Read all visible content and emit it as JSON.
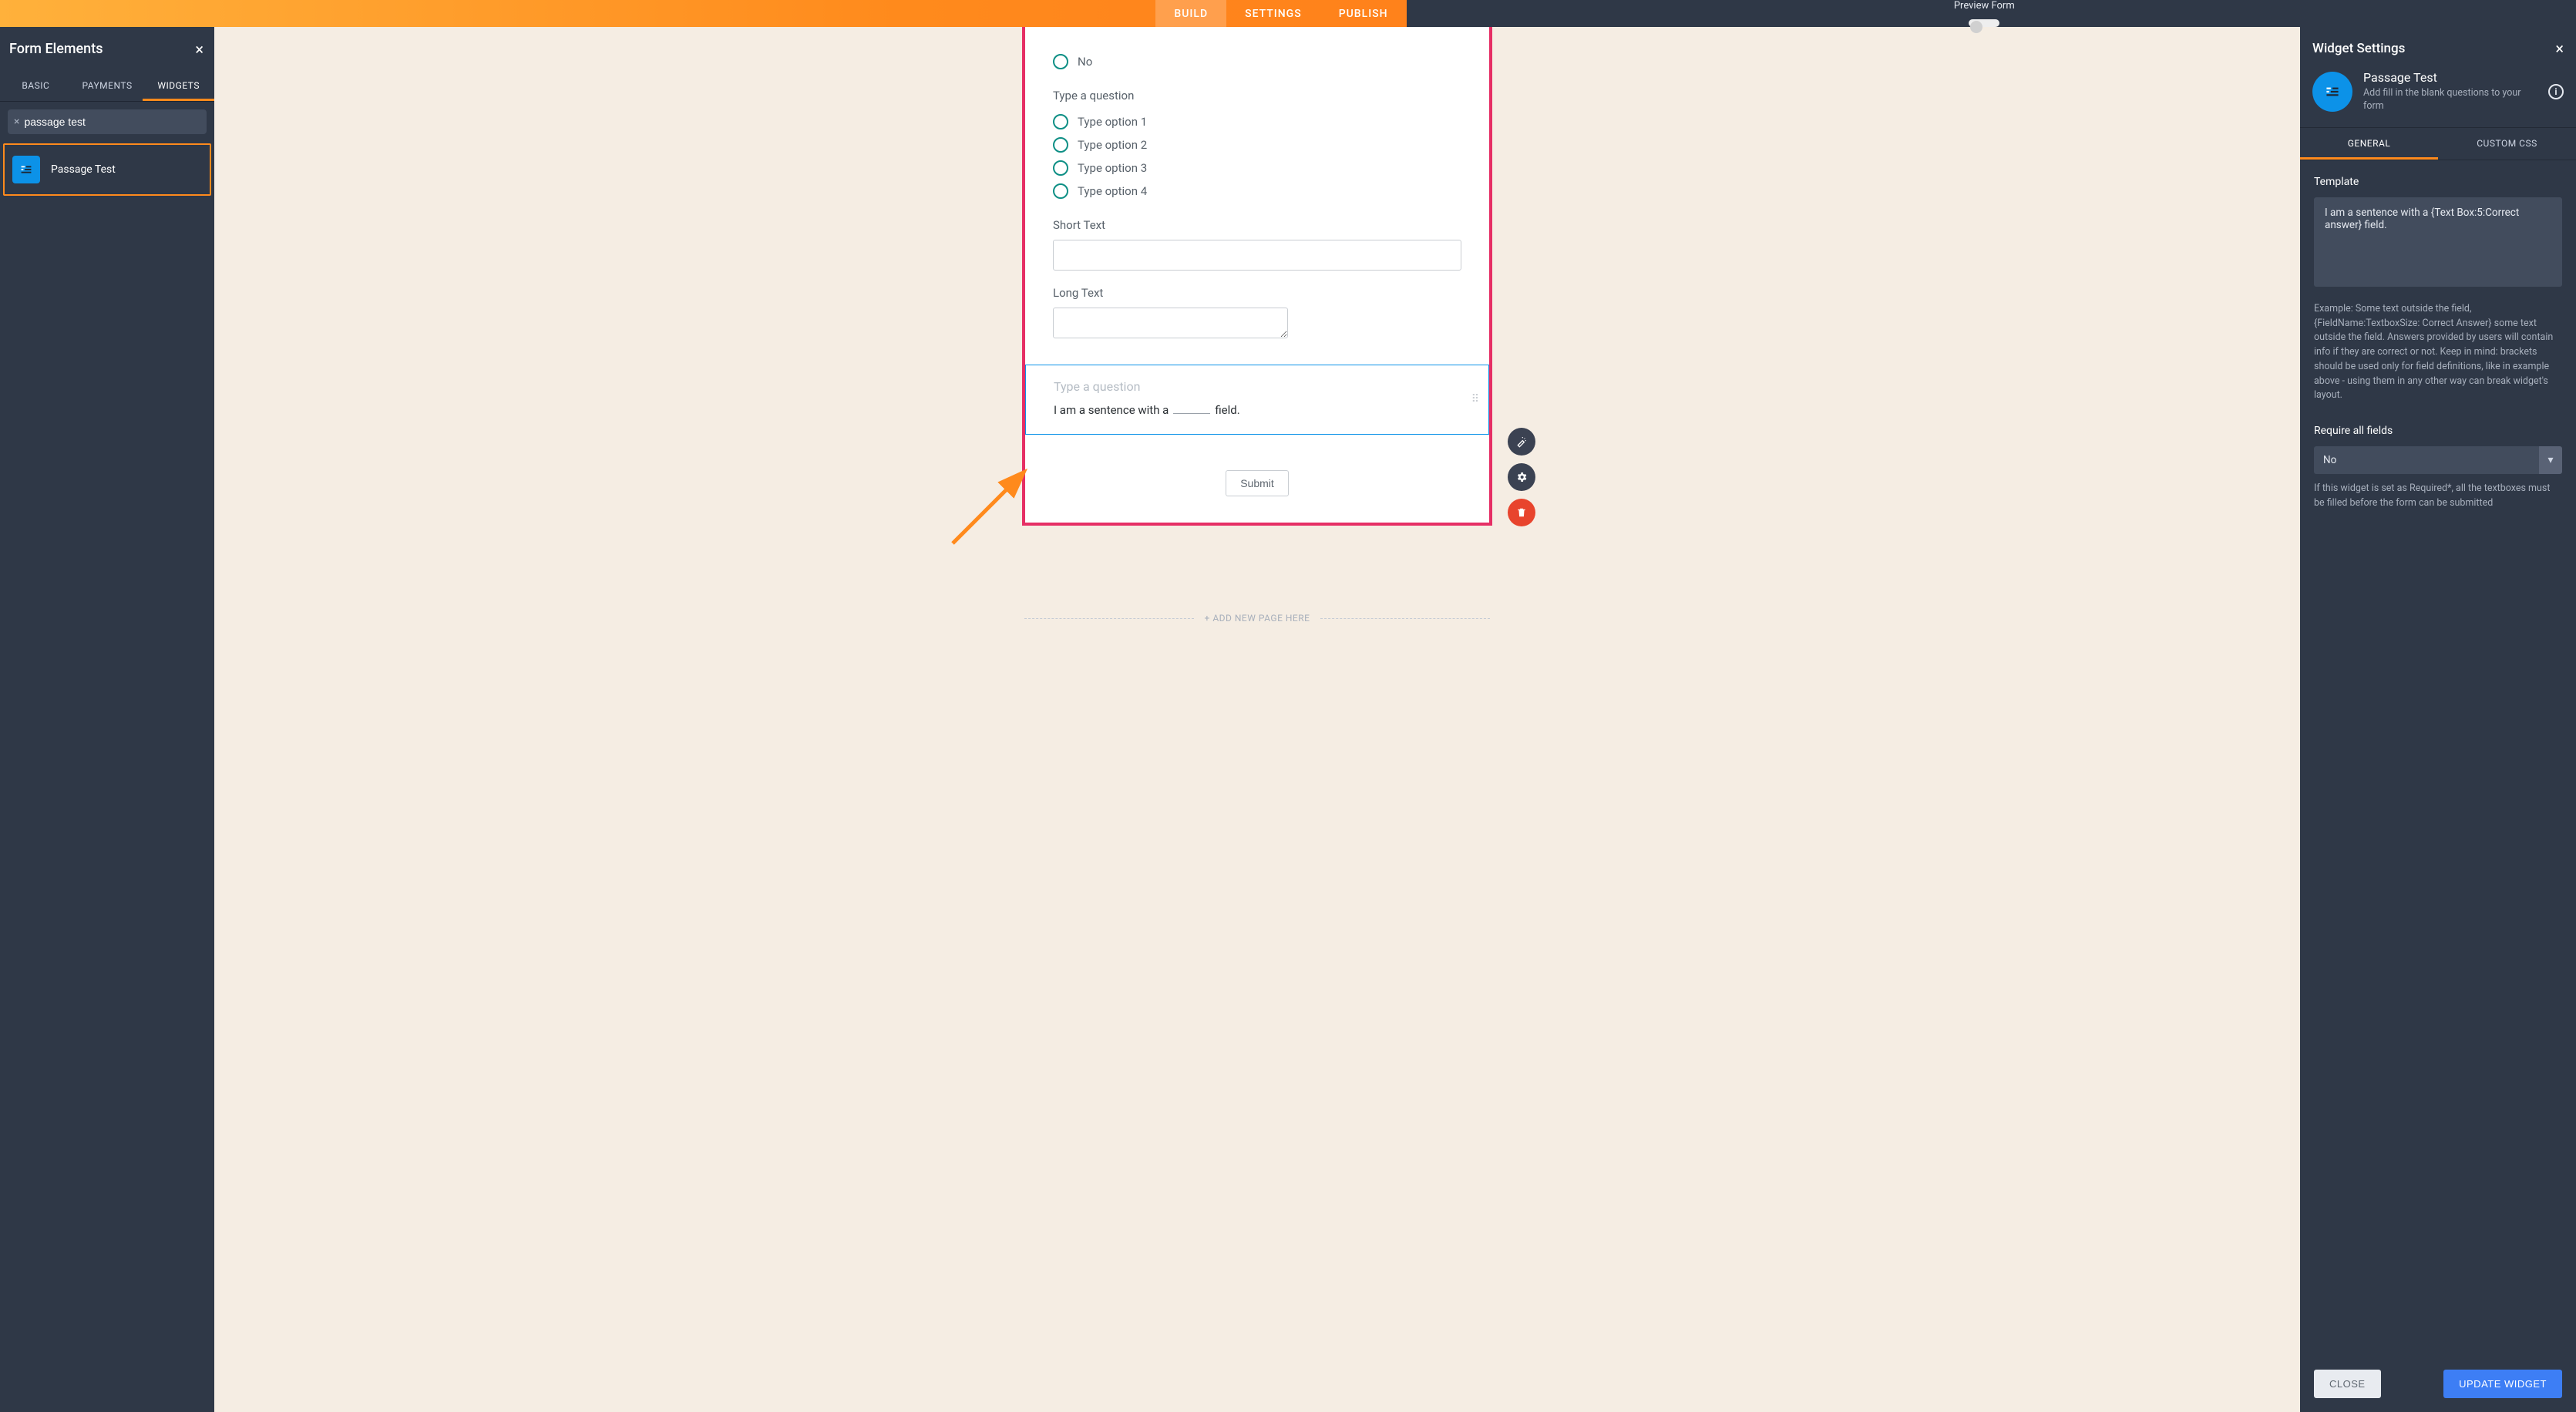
{
  "topbar": {
    "tabs": {
      "build": "BUILD",
      "settings": "SETTINGS",
      "publish": "PUBLISH"
    },
    "preview_label": "Preview Form"
  },
  "left_panel": {
    "title": "Form Elements",
    "tabs": {
      "basic": "BASIC",
      "payments": "PAYMENTS",
      "widgets": "WIDGETS"
    },
    "search_value": "passage test",
    "search_placeholder": "",
    "result_label": "Passage Test"
  },
  "form": {
    "field0": {
      "option_no": "No"
    },
    "field1": {
      "question": "Type a question",
      "options": [
        "Type option 1",
        "Type option 2",
        "Type option 3",
        "Type option 4"
      ]
    },
    "short_text_label": "Short Text",
    "long_text_label": "Long Text",
    "passage": {
      "placeholder": "Type a question",
      "sentence_before": "I am a sentence with a",
      "sentence_after": "field."
    },
    "submit": "Submit",
    "add_page": "+ ADD NEW PAGE HERE"
  },
  "right_panel": {
    "title": "Widget Settings",
    "widget_title": "Passage Test",
    "widget_sub": "Add fill in the blank questions to your form",
    "tabs": {
      "general": "GENERAL",
      "custom_css": "CUSTOM CSS"
    },
    "template_label": "Template",
    "template_value": "I am a sentence with a {Text Box:5:Correct answer} field.",
    "template_help": "Example: Some text outside the field, {FieldName:TextboxSize: Correct Answer} some text outside the field. Answers provided by users will contain info if they are correct or not. Keep in mind: brackets should be used only for field definitions, like in example above - using them in any other way can break widget's layout.",
    "require_label": "Require all fields",
    "require_value": "No",
    "require_help": "If this widget is set as Required*, all the textboxes must be filled before the form can be submitted",
    "close": "CLOSE",
    "update": "UPDATE WIDGET"
  }
}
